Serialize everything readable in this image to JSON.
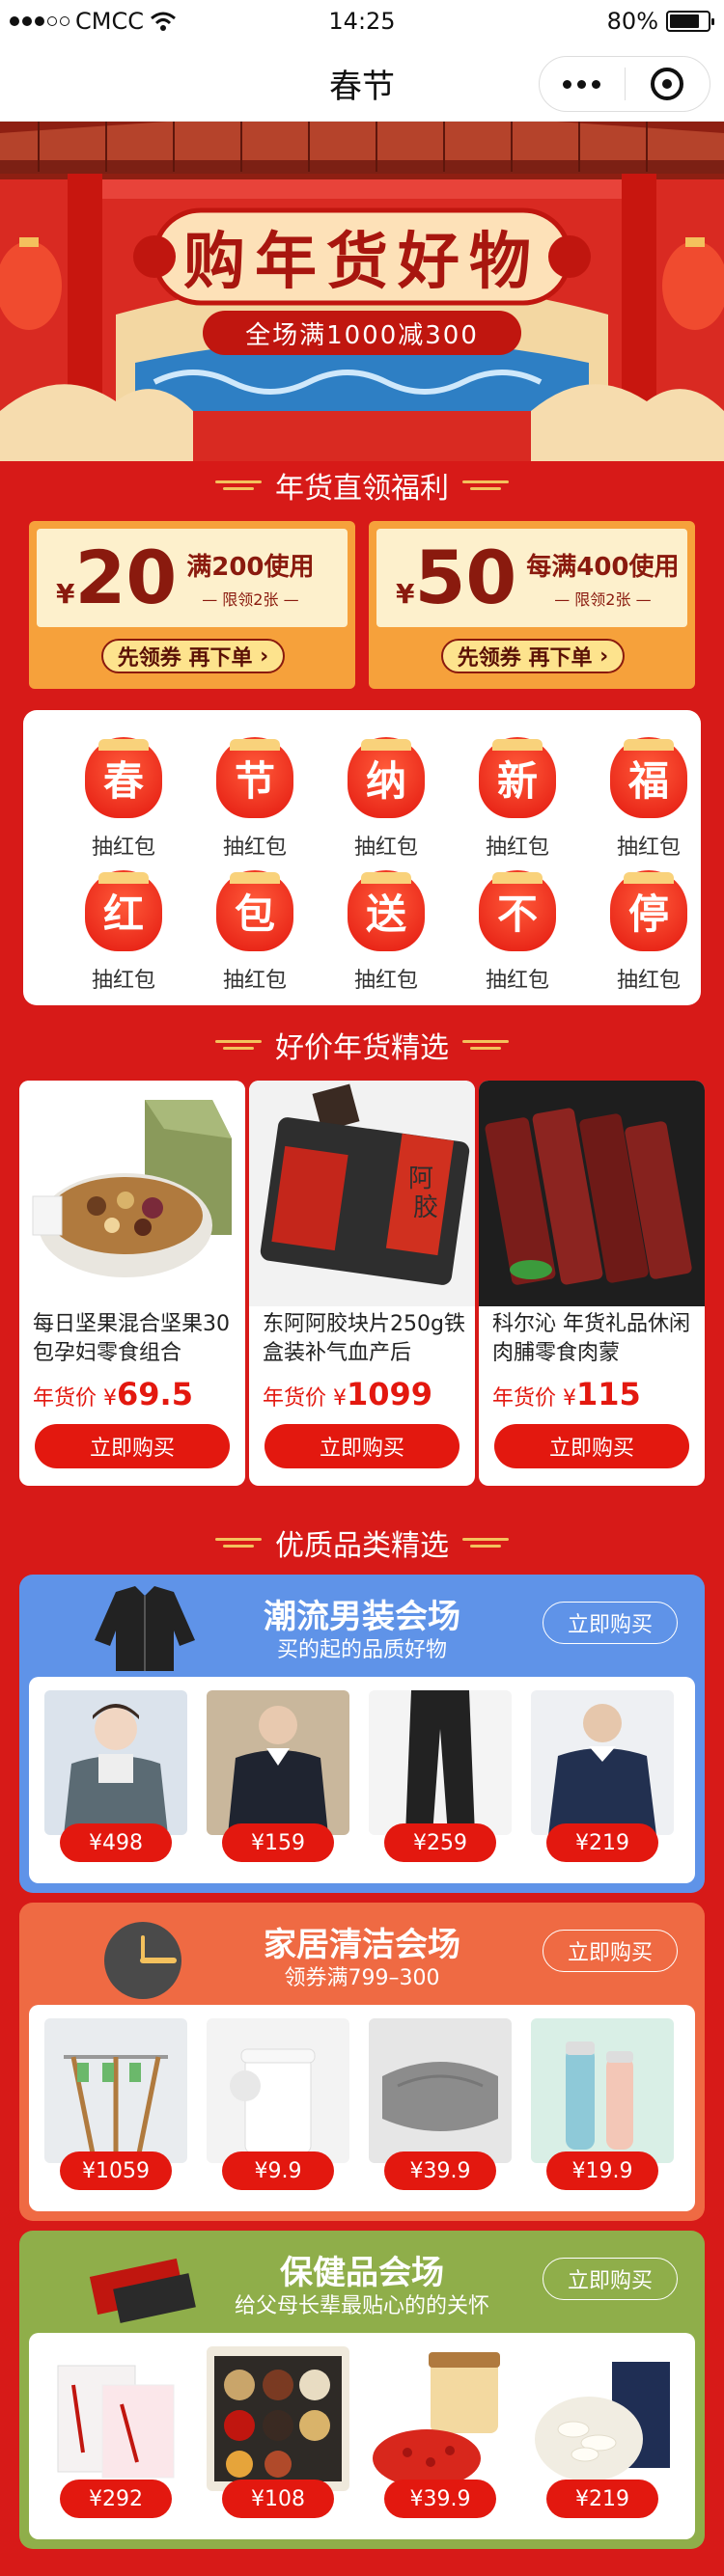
{
  "status_bar": {
    "carrier": "CMCC",
    "time": "14:25",
    "battery": "80%",
    "battery_level": 0.8
  },
  "navbar": {
    "title": "春节"
  },
  "banner": {
    "title": "购年货好物",
    "subtitle": "全场满1000减300"
  },
  "coupons_section": {
    "title": "年货直领福利"
  },
  "coupons": [
    {
      "currency": "¥",
      "amount": "20",
      "condition": "满200使用",
      "limit": "限领2张",
      "button": "先领券 再下单"
    },
    {
      "currency": "¥",
      "amount": "50",
      "condition": "每满400使用",
      "limit": "限领2张",
      "button": "先领券 再下单"
    }
  ],
  "red_packets": [
    {
      "char": "春",
      "label": "抽红包"
    },
    {
      "char": "节",
      "label": "抽红包"
    },
    {
      "char": "纳",
      "label": "抽红包"
    },
    {
      "char": "新",
      "label": "抽红包"
    },
    {
      "char": "福",
      "label": "抽红包"
    },
    {
      "char": "红",
      "label": "抽红包"
    },
    {
      "char": "包",
      "label": "抽红包"
    },
    {
      "char": "送",
      "label": "抽红包"
    },
    {
      "char": "不",
      "label": "抽红包"
    },
    {
      "char": "停",
      "label": "抽红包"
    }
  ],
  "products_section": {
    "title": "好价年货精选"
  },
  "products": [
    {
      "name": "每日坚果混合坚果30包孕妇零食组合",
      "price_label": "年货价 ¥",
      "price": "69.5",
      "button": "立即购买"
    },
    {
      "name": "东阿阿胶块片250g铁盒装补气血产后",
      "price_label": "年货价 ¥",
      "price": "1099",
      "button": "立即购买"
    },
    {
      "name": "科尔沁 年货礼品休闲肉脯零食肉蒙",
      "price_label": "年货价 ¥",
      "price": "115",
      "button": "立即购买"
    }
  ],
  "category_section": {
    "title": "优质品类精选"
  },
  "venues": [
    {
      "title": "潮流男装会场",
      "subtitle": "买的起的品质好物",
      "button": "立即购买",
      "color": "#5f93e8",
      "items": [
        {
          "price": "¥498"
        },
        {
          "price": "¥159"
        },
        {
          "price": "¥259"
        },
        {
          "price": "¥219"
        }
      ]
    },
    {
      "title": "家居清洁会场",
      "subtitle": "领券满799–300",
      "button": "立即购买",
      "color": "#ef6a43",
      "items": [
        {
          "price": "¥1059"
        },
        {
          "price": "¥9.9"
        },
        {
          "price": "¥39.9"
        },
        {
          "price": "¥19.9"
        }
      ]
    },
    {
      "title": "保健品会场",
      "subtitle": "给父母长辈最贴心的的关怀",
      "button": "立即购买",
      "color": "#8fae4a",
      "items": [
        {
          "price": "¥292"
        },
        {
          "price": "¥108"
        },
        {
          "price": "¥39.9"
        },
        {
          "price": "¥219"
        }
      ]
    }
  ],
  "colors": {
    "page_bg": "#d71a18",
    "accent_red": "#e3180f",
    "coupon_orange": "#f6a13b",
    "gold": "#f4c15d"
  }
}
